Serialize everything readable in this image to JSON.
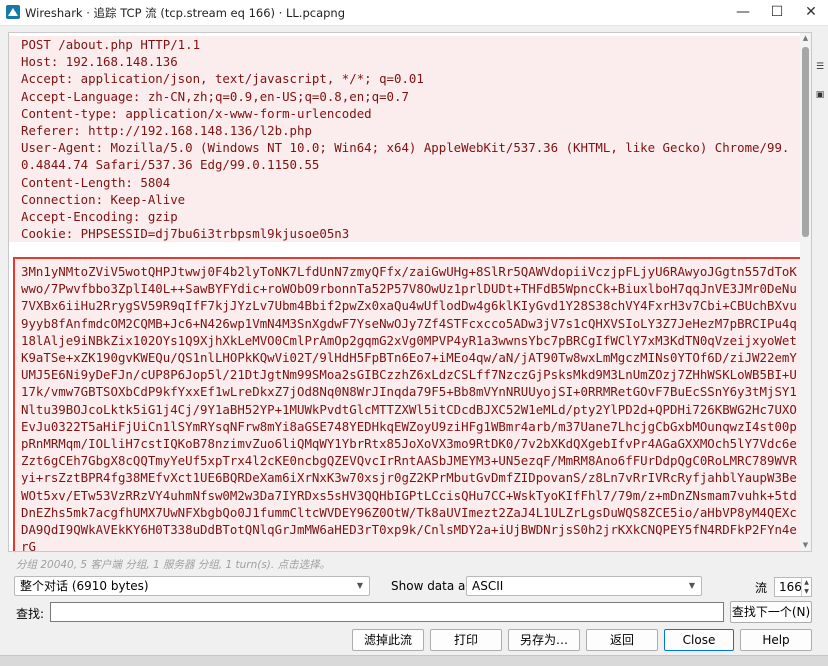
{
  "window": {
    "title": "Wireshark · 追踪 TCP 流 (tcp.stream eq 166) · LL.pcapng",
    "app_icon": "wireshark-fin-icon",
    "controls": [
      "minimize-icon",
      "maximize-icon",
      "close-icon"
    ]
  },
  "request": {
    "lines": [
      "POST /about.php HTTP/1.1",
      "Host: 192.168.148.136",
      "Accept: application/json, text/javascript, */*; q=0.01",
      "Accept-Language: zh-CN,zh;q=0.9,en-US;q=0.8,en;q=0.7",
      "Content-type: application/x-www-form-urlencoded",
      "Referer: http://192.168.148.136/l2b.php",
      "User-Agent: Mozilla/5.0 (Windows NT 10.0; Win64; x64) AppleWebKit/537.36 (KHTML, like Gecko) Chrome/99.0.4844.74 Safari/537.36 Edg/99.0.1150.55",
      "Content-Length: 5804",
      "Connection: Keep-Alive",
      "Accept-Encoding: gzip",
      "Cookie: PHPSESSID=dj7bu6i3trbpsml9kjusoe05n3"
    ],
    "body": "3Mn1yNMtoZViV5wotQHPJtwwj0F4b2lyToNK7LfdUnN7zmyQFfx/zaiGwUHg+8SlRr5QAWVdopiiVczjpFLjyU6RAwyoJGgtn557dToKwwo/7Pwvfbbo3ZplI40L++SawBYFYdic+roWObO9rbonnTa52P57V8OwUz1prlDUDt+THFdB5WpncCk+BiuxlboH7qqJnVE3JMr0DeNu7VXBx6iiHu2RrygSV59R9qIfF7kjJYzLv7Ubm4Bbif2pwZx0xaQu4wUflodDw4g6klKIyGvd1Y28S38chVY4FxrH3v7Cbi+CBUchBXvu9yyb8fAnfmdcOM2CQMB+Jc6+N426wp1VmN4M3SnXgdwF7YseNwOJy7Zf4STFcxcco5ADw3jV7s1cQHXVSIoLY3Z7JeHezM7pBRCIPu4q18lAlje9iNBkZix102OYs1Q9XjhXkLeMVO0CmlPrAmOp2gqmG2xVg0MPVP4yR1a3wwnsYbc7pBRCgIfWClY7xM3KdTN0qVzeijxyoWetK9aTSe+xZK190gvKWEQu/QS1nlLHOPkKQwVi02T/9lHdH5FpBTn6Eo7+iMEo4qw/aN/jAT90Tw8wxLmMgczMINs0YTOf6D/ziJW22emYUMJ5E6Ni9yDeFJn/cUP8P6Jop5l/21DtJgtNm99SMoa2sGIBCzzhZ6xLdzCSLff7NzczGjPsksMkd9M3LnUmZOzj7ZHhWSKLoWB5BI+U17k/vmw7GBTSOXbCdP9kfYxxEf1wLreDkxZ7jOd8Nq0N8WrJInqda79F5+Bb8mVYnNRUUyojSI+0RRMRetGOvF7BuEcSSnY6y3tMjSY1Nltu39BOJcoLktk5iG1j4Cj/9Y1aBH52YP+1MUWkPvdtGlcMTTZXWl5itCDcdBJXC52W1eMLd/pty2YlPD2d+QPDHi726KBWG2Hc7UXOEvJu0322T5aHiFjUiCn1lSYmRYsqNFrw8mYi8aGSE748YEDHkqEWZoyU9ziHFg1WBmr4arb/m37Uane7LhcjgCbGxbMOunqwzI4st00ppRnMRMqm/IOLliH7cstIQKoB78nzimvZuo6liQMqWY1YbrRtx85JoXoVX3mo9RtDK0/7v2bXKdQXgebIfvPr4AGaGXXMOch5lY7Vdc6eZzt6gCEh7GbgX8cQQTmyYeUf5xpTrx4l2cKE0ncbgQZEVQvcIrRntAASbJMEYM3+UN5ezqF/MmRM8Ano6fFUrDdpQgC0RoLMRC789WVRyi+rsZztBPR4fg38MEfvXct1UE6BQRDeXam6iXrNxK3w70xsjr0gZ2KPrMbutGvDmfZIDpovanS/z8Ln7vRrIVRcRyfjahblYaupW3BeWOt5xv/ETw53VzRRzVY4uhmNfsw0M2w3Da7IYRDxs5sHV3QQHbIGPtLCcisQHu7CC+WskTyoKIfFhl7/79m/z+mDnZNsmam7vuhk+5tdDnEZhs5mk7acgfhUMX7UwNFXbgbQo0J1fummCltcWVDEY96Z0OtW/Tk8aUVImezt2ZaJ4L1ULZrLgsDuWQS8ZCE5io/aHbVP8yM4QEXcDA9QdI9QWkAVEkKY6H0T338uDdBTotQNlqGrJmMW6aHED3rT0xp9k/CnlsMDY2a+iUjBWDNrjsS0h2jrKXkCNQPEY5fN4RDFkP2FYn4erG"
  },
  "status_text": "分组 20040, 5 客户端 分组, 1 服务器 分组, 1 turn(s). 点击选择。",
  "controls": {
    "conversation_select": "整个对话 (6910 bytes)",
    "show_data_label": "Show data as",
    "show_data_select": "ASCII",
    "stream_label": "流",
    "stream_value": "166",
    "find_label": "查找:",
    "find_placeholder": "",
    "find_next_button": "查找下一个(N)"
  },
  "buttons": {
    "filter_out": "滤掉此流",
    "print": "打印",
    "save_as": "另存为…",
    "back": "返回",
    "close": "Close",
    "help": "Help"
  }
}
